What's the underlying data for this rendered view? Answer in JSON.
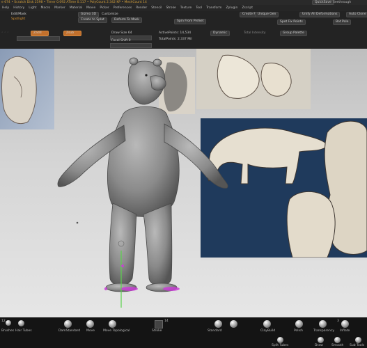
{
  "status_bar": {
    "text": "e 674 • Scratch Disk 2598 • Timer 0.092 ATime 0.117 • PolyCount 2.342 KP • MeshCount 14",
    "quicksave": "QuickSave",
    "right_info": "Seethrough"
  },
  "menu": [
    "Help",
    "History",
    "Light",
    "Macro",
    "Marker",
    "Material",
    "Movie",
    "Picker",
    "Preferences",
    "Render",
    "Stencil",
    "Stroke",
    "Texture",
    "Tool",
    "Transform",
    "Zplugin",
    "Zscript"
  ],
  "palette": {
    "left_labels": [
      "Edit/Mask",
      "Spotlight"
    ],
    "row1": [
      "Gizmo 3D",
      "Customize",
      "Create PC",
      "Unique Gen",
      "Unify All Deformations",
      "Auto Clone"
    ],
    "row2": [
      "Create to Splat",
      "Deform To Mask",
      "Spin From PreSet",
      "Spot Fix Points",
      "Bot Pole"
    ],
    "rgb_intensity": "Total Intensity",
    "z_intensity": "Total Z",
    "draw_size": "Draw Size 64",
    "focal_shift": "Focal Shift 0",
    "active_points": "ActivePoints: 14,534",
    "total_points": "TotalPoints: 2.337 Mil",
    "dynamic": "Dynamic",
    "group_palette": "Group Palette",
    "buttons_orange": [
      "Zadd",
      "Zsub"
    ]
  },
  "shelf": {
    "tools": [
      "Brushes",
      "Hair Tubes",
      "DamStandard",
      "Move",
      "Move Topological",
      "Stroke",
      "Standard",
      "ClayBuild",
      "Polish",
      "Transparency",
      "Inflate"
    ],
    "tools_row2": [
      "Split Tubes",
      "Draw",
      "Smooth",
      "Sub Tools"
    ],
    "counts": [
      "12",
      "14",
      "3"
    ]
  }
}
